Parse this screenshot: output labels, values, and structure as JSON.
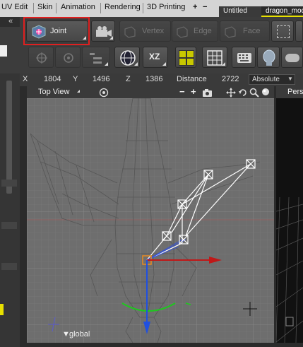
{
  "menu": {
    "items": [
      "UV Edit",
      "Skin",
      "Animation",
      "Rendering",
      "3D Printing"
    ],
    "plus": "+",
    "minus": "−"
  },
  "tabs": [
    {
      "label": "Untitled",
      "active": false
    },
    {
      "label": "dragon_mode",
      "active": true
    }
  ],
  "toolbar": {
    "joint_label": "Joint",
    "vertex_label": "Vertex",
    "edge_label": "Edge",
    "face_label": "Face",
    "xz_label": "XZ",
    "highlight_color": "#e02020"
  },
  "coords": {
    "x_label": "X",
    "x_value": "1804",
    "y_label": "Y",
    "y_value": "1496",
    "z_label": "Z",
    "z_value": "1386",
    "distance_label": "Distance",
    "distance_value": "2722",
    "mode": "Absolute"
  },
  "viewport": {
    "view_name": "Top View",
    "right_view_name": "Pers",
    "global_label": "global",
    "bg_color": "#6e6e6e",
    "grid_color": "#808080",
    "mesh_color": "#5a5a5a"
  }
}
